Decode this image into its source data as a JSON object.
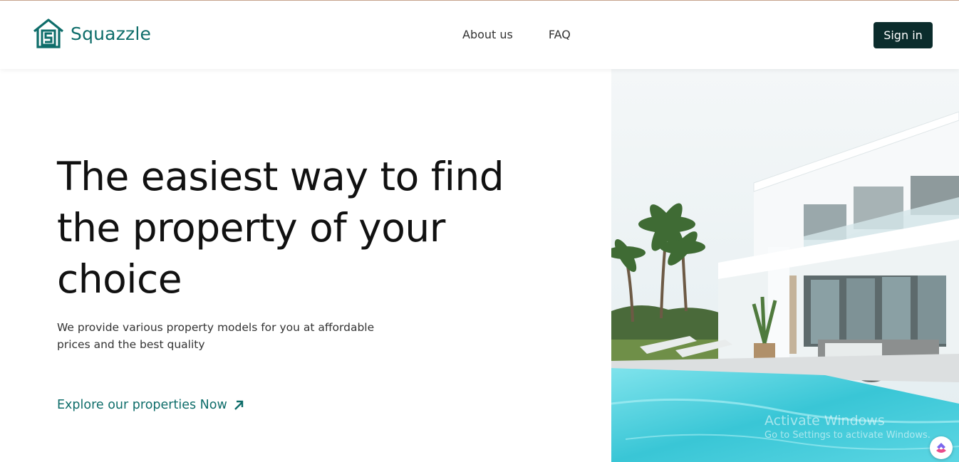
{
  "brand": {
    "name": "Squazzle",
    "logo_icon": "house-s-icon",
    "color": "#0e6d6a"
  },
  "nav": {
    "items": [
      {
        "label": "About us"
      },
      {
        "label": "FAQ"
      }
    ]
  },
  "header": {
    "signin_label": "Sign in",
    "signin_color": "#0b2c2c"
  },
  "hero": {
    "title": "The easiest way to find the property of your choice",
    "subtitle": "We provide various property models for you at affordable prices and the best quality",
    "cta_label": "Explore our properties Now",
    "cta_icon": "arrow-up-right-icon",
    "image": "villa-with-pool-image"
  },
  "watermark": {
    "line1": "Activate Windows",
    "line2": "Go to Settings to activate Windows."
  },
  "fab": {
    "icon": "clickup-icon"
  }
}
